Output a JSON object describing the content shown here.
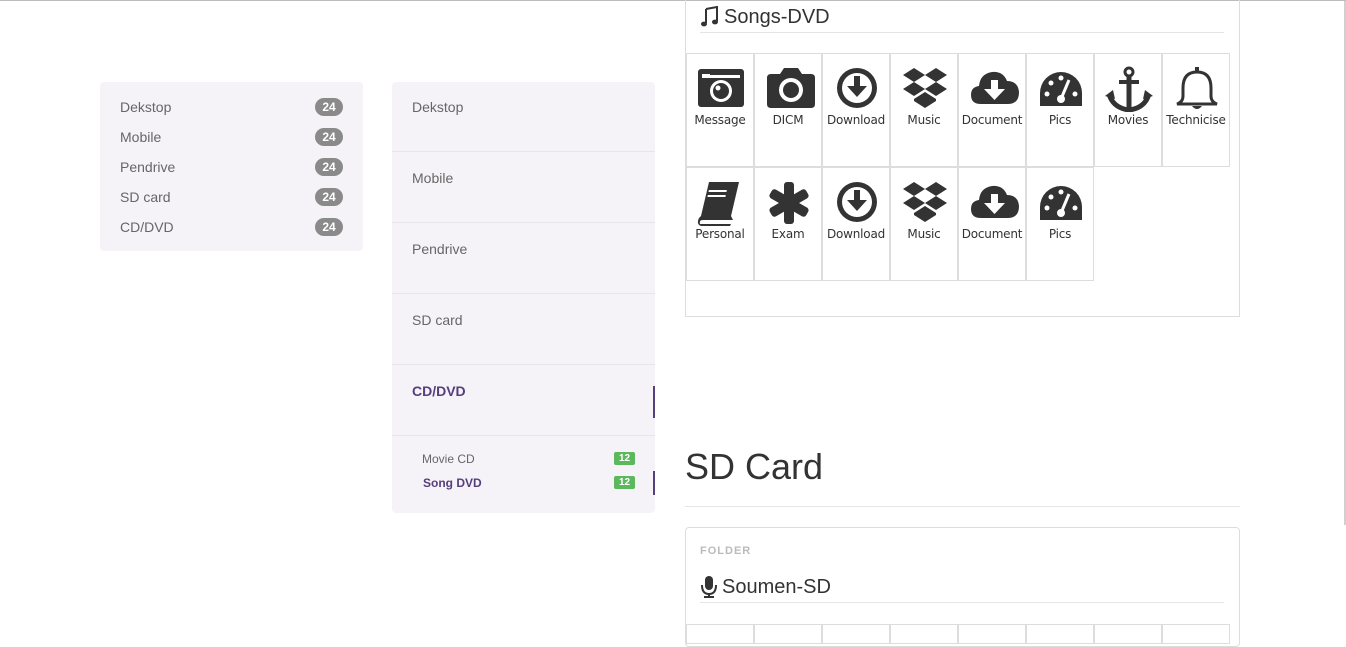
{
  "sidebar_small": {
    "items": [
      {
        "label": "Dekstop",
        "count": "24"
      },
      {
        "label": "Mobile",
        "count": "24"
      },
      {
        "label": "Pendrive",
        "count": "24"
      },
      {
        "label": "SD card",
        "count": "24"
      },
      {
        "label": "CD/DVD",
        "count": "24"
      }
    ]
  },
  "sidebar_big": {
    "items": [
      {
        "label": "Dekstop"
      },
      {
        "label": "Mobile"
      },
      {
        "label": "Pendrive"
      },
      {
        "label": "SD card"
      },
      {
        "label": "CD/DVD",
        "active": true
      }
    ],
    "subitems": [
      {
        "label": "Movie CD",
        "count": "12"
      },
      {
        "label": "Song DVD",
        "count": "12",
        "active": true
      }
    ]
  },
  "songs_panel": {
    "title": "Songs-DVD",
    "title_icon": "music-icon",
    "tiles": [
      {
        "label": "Message",
        "icon": "camera-retro-icon"
      },
      {
        "label": "DICM",
        "icon": "camera-icon"
      },
      {
        "label": "Download",
        "icon": "download-circle-icon"
      },
      {
        "label": "Music",
        "icon": "dropbox-icon"
      },
      {
        "label": "Document",
        "icon": "cloud-download-icon"
      },
      {
        "label": "Pics",
        "icon": "dashboard-icon"
      },
      {
        "label": "Movies",
        "icon": "anchor-icon"
      },
      {
        "label": "Technicise",
        "icon": "bell-icon"
      },
      {
        "label": "Personal",
        "icon": "book-icon"
      },
      {
        "label": "Exam",
        "icon": "asterisk-icon"
      },
      {
        "label": "Download",
        "icon": "download-circle-icon"
      },
      {
        "label": "Music",
        "icon": "dropbox-icon"
      },
      {
        "label": "Document",
        "icon": "cloud-download-icon"
      },
      {
        "label": "Pics",
        "icon": "dashboard-icon"
      }
    ]
  },
  "sd_section": {
    "heading": "SD Card",
    "folder_label": "FOLDER",
    "title": "Soumen-SD",
    "title_icon": "microphone-icon"
  }
}
